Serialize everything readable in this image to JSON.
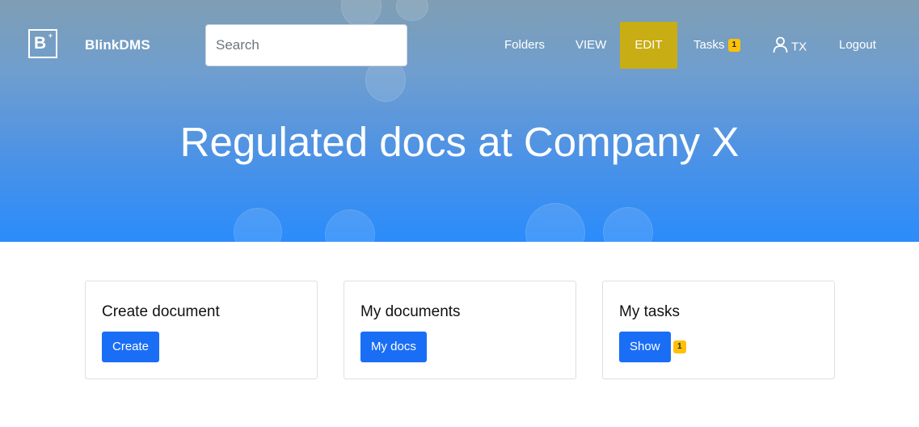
{
  "brand": {
    "name": "BlinkDMS",
    "logo_letter": "B",
    "logo_mark": "+"
  },
  "search": {
    "placeholder": "Search"
  },
  "nav": {
    "folders": "Folders",
    "view": "VIEW",
    "edit": "EDIT",
    "tasks": "Tasks",
    "tasks_badge": "1",
    "user": "TX",
    "logout": "Logout"
  },
  "hero": {
    "title": "Regulated docs at Company X"
  },
  "cards": [
    {
      "title": "Create document",
      "button": "Create"
    },
    {
      "title": "My documents",
      "button": "My docs"
    },
    {
      "title": "My tasks",
      "button": "Show",
      "badge": "1"
    }
  ],
  "colors": {
    "primary_button": "#1a6ef5",
    "edit_active": "#c9ad14",
    "badge": "#ffc107",
    "hero_bottom": "#2a8cfb"
  }
}
